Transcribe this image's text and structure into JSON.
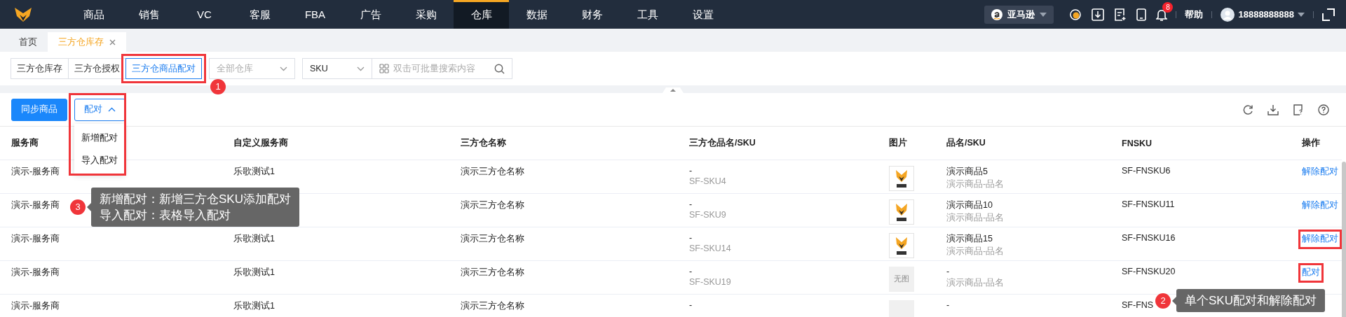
{
  "nav": {
    "items": [
      {
        "label": "商品",
        "selected": false
      },
      {
        "label": "销售",
        "selected": false
      },
      {
        "label": "VC",
        "selected": false
      },
      {
        "label": "客服",
        "selected": false
      },
      {
        "label": "FBA",
        "selected": false
      },
      {
        "label": "广告",
        "selected": false
      },
      {
        "label": "采购",
        "selected": false
      },
      {
        "label": "仓库",
        "selected": true
      },
      {
        "label": "数据",
        "selected": false
      },
      {
        "label": "财务",
        "selected": false
      },
      {
        "label": "工具",
        "selected": false
      },
      {
        "label": "设置",
        "selected": false
      }
    ],
    "platform": "亚马逊",
    "notification_count": "8",
    "help": "帮助",
    "user": "18888888888"
  },
  "page_tabs": [
    {
      "label": "首页",
      "selected": false,
      "closable": false
    },
    {
      "label": "三方仓库存",
      "selected": true,
      "closable": true
    }
  ],
  "filters": {
    "views": [
      {
        "label": "三方仓库存",
        "selected": false,
        "highlighted": false
      },
      {
        "label": "三方仓授权",
        "selected": false,
        "highlighted": false
      },
      {
        "label": "三方仓商品配对",
        "selected": true,
        "highlighted": true
      }
    ],
    "warehouse_select": {
      "placeholder": "全部仓库"
    },
    "field_select": {
      "value": "SKU"
    },
    "search": {
      "placeholder": "双击可批量搜索内容"
    }
  },
  "toolbar": {
    "sync_button": "同步商品",
    "pair_button": "配对",
    "pair_menu": {
      "expanded": true,
      "highlighted": true,
      "items": [
        "新增配对",
        "导入配对"
      ]
    }
  },
  "table": {
    "columns": [
      "服务商",
      "自定义服务商",
      "三方仓名称",
      "三方仓品名/SKU",
      "图片",
      "品名/SKU",
      "FNSKU",
      "操作"
    ],
    "rows": [
      {
        "provider": "演示-服务商",
        "custom_provider": "乐歌测试1",
        "warehouse_name": "演示三方仓名称",
        "warehouse_item": "-",
        "warehouse_sku": "SF-SKU4",
        "product": "演示商品5",
        "product_name": "演示商品-品名",
        "fnsku": "SF-FNSKU6",
        "action": "解除配对",
        "highlighted": false
      },
      {
        "provider": "演示-服务商",
        "warehouse_name": "演示三方仓名称",
        "warehouse_item": "-",
        "warehouse_sku": "SF-SKU9",
        "product": "演示商品10",
        "product_name": "演示商品-品名",
        "fnsku": "SF-FNSKU11",
        "action": "解除配对",
        "highlighted": false
      },
      {
        "provider": "演示-服务商",
        "custom_provider": "乐歌测试1",
        "warehouse_name": "演示三方仓名称",
        "warehouse_item": "-",
        "warehouse_sku": "SF-SKU14",
        "product": "演示商品15",
        "product_name": "演示商品-品名",
        "fnsku": "SF-FNSKU16",
        "action": "解除配对",
        "highlighted": true
      },
      {
        "provider": "演示-服务商",
        "custom_provider": "乐歌测试1",
        "warehouse_name": "演示三方仓名称",
        "warehouse_item": "-",
        "warehouse_sku": "SF-SKU19",
        "image": {
          "kind": "none",
          "text": "无图"
        },
        "product": "-",
        "product_name": "演示商品-品名",
        "fnsku": "SF-FNSKU20",
        "action": "配对",
        "highlighted": true
      },
      {
        "provider": "演示-服务商",
        "custom_provider": "乐歌测试1",
        "warehouse_name": "演示三方仓名称",
        "warehouse_item": "-",
        "image": {
          "kind": "none"
        },
        "product": "-",
        "fnsku": "SF-FNS"
      }
    ]
  },
  "callouts": [
    {
      "number": "1"
    },
    {
      "number": "2",
      "lines": [
        "单个SKU配对和解除配对"
      ]
    },
    {
      "number": "3",
      "lines": [
        "新增配对：新增三方仓SKU添加配对",
        "导入配对：表格导入配对"
      ]
    }
  ]
}
